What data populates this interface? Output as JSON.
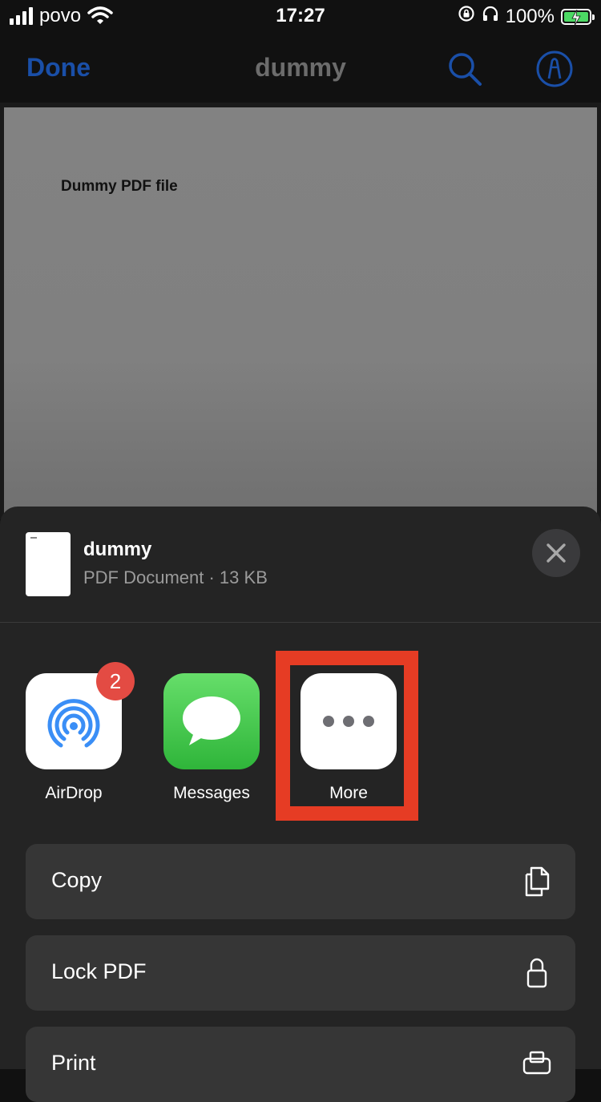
{
  "status_bar": {
    "carrier": "povo",
    "time": "17:27",
    "battery_percent": "100%"
  },
  "nav": {
    "done_label": "Done",
    "title": "dummy",
    "accent_color": "#1a4fa8"
  },
  "document": {
    "text": "Dummy PDF file"
  },
  "share_sheet": {
    "file": {
      "name": "dummy",
      "meta": "PDF Document · 13 KB"
    },
    "apps": [
      {
        "label": "AirDrop",
        "icon": "airdrop-icon",
        "badge": "2"
      },
      {
        "label": "Messages",
        "icon": "messages-icon"
      },
      {
        "label": "More",
        "icon": "more-dots-icon"
      }
    ],
    "actions": [
      {
        "label": "Copy",
        "icon": "copy-icon"
      },
      {
        "label": "Lock PDF",
        "icon": "lock-icon"
      },
      {
        "label": "Print",
        "icon": "print-icon"
      }
    ],
    "highlight_color": "#e63c24"
  }
}
